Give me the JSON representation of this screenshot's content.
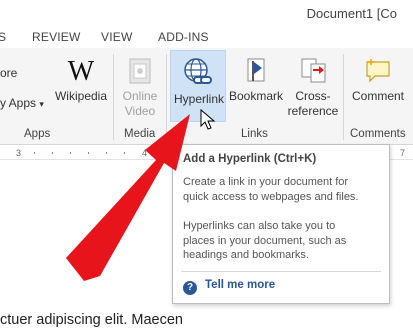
{
  "window": {
    "title": "Document1 [Co"
  },
  "tabs": [
    {
      "label": "S"
    },
    {
      "label": "REVIEW"
    },
    {
      "label": "VIEW"
    },
    {
      "label": "ADD-INS"
    }
  ],
  "ribbon": {
    "store_label": "ore",
    "my_apps_label": "y Apps",
    "my_apps_caret": "▾",
    "wikipedia_label": "Wikipedia",
    "online_video_label_1": "Online",
    "online_video_label_2": "Video",
    "hyperlink_label": "Hyperlink",
    "bookmark_label": "Bookmark",
    "crossref_label_1": "Cross-",
    "crossref_label_2": "reference",
    "comment_label": "Comment",
    "groups": {
      "apps": "Apps",
      "media": "Media",
      "links": "Links",
      "comments": "Comments"
    }
  },
  "ruler": {
    "ticks": [
      "3",
      "4",
      "7"
    ]
  },
  "document": {
    "text": "ctuer adipiscing elit. Maecen"
  },
  "tooltip": {
    "title": "Add a Hyperlink (Ctrl+K)",
    "para1_line1": "Create a link in your document for",
    "para1_line2": "quick access to webpages and files.",
    "para2_line1": "Hyperlinks can also take you to",
    "para2_line2": "places in your document, such as",
    "para2_line3": "headings and bookmarks.",
    "help_glyph": "?",
    "tell_me_more": "Tell me more"
  },
  "colors": {
    "accent": "#2b579a",
    "arrow": "#e8141b",
    "hover": "#cfe2f6"
  }
}
